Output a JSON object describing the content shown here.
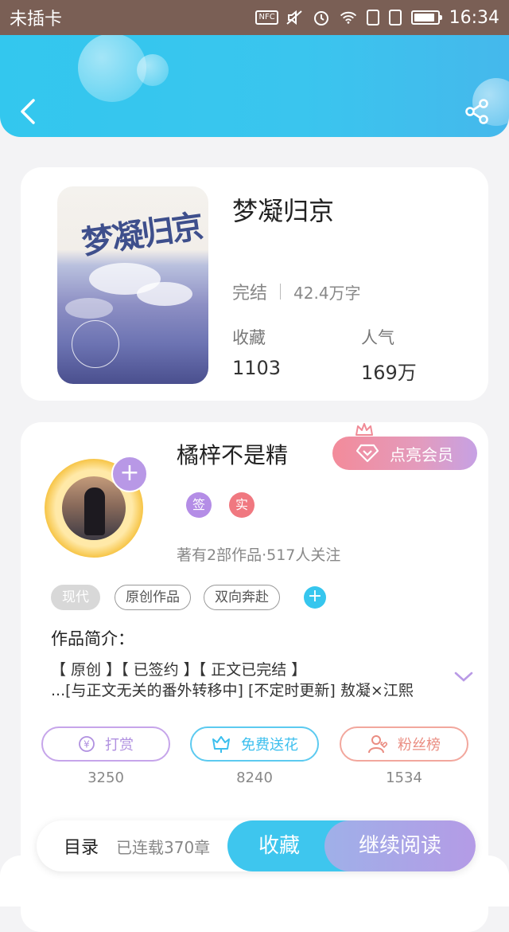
{
  "status_bar": {
    "carrier": "未插卡",
    "nfc": "NFC",
    "time": "16:34",
    "battery_level": 0.8
  },
  "book": {
    "title": "梦凝归京",
    "cover_title": "梦凝归京",
    "status": "完结",
    "word_count": "42.4万字",
    "collect_label": "收藏",
    "collect_count": "1103",
    "popularity_label": "人气",
    "popularity_count": "169万"
  },
  "author": {
    "name": "橘梓不是精",
    "vip_label": "点亮会员",
    "badge_sign": "签",
    "badge_real": "实",
    "meta": "著有2部作品·517人关注",
    "follow_symbol": "+"
  },
  "tags": [
    "现代",
    "原创作品",
    "双向奔赴"
  ],
  "intro": {
    "heading": "作品简介：",
    "line1": "【 原创 】【 已签约 】【 正文已完结 】",
    "line2": "...[与正文无关的番外转移中] [不定时更新] 敖凝×江熙"
  },
  "actions": {
    "tip": {
      "label": "打赏",
      "count": "3250"
    },
    "flower": {
      "label": "免费送花",
      "count": "8240"
    },
    "fans": {
      "label": "粉丝榜",
      "count": "1534"
    }
  },
  "bottom_bar": {
    "toc_label": "目录",
    "serial_text": "已连载370章",
    "collect_label": "收藏",
    "read_label": "继续阅读"
  },
  "colors": {
    "accent": "#3ec6ee",
    "purple": "#b48de6",
    "pink": "#f07880"
  }
}
